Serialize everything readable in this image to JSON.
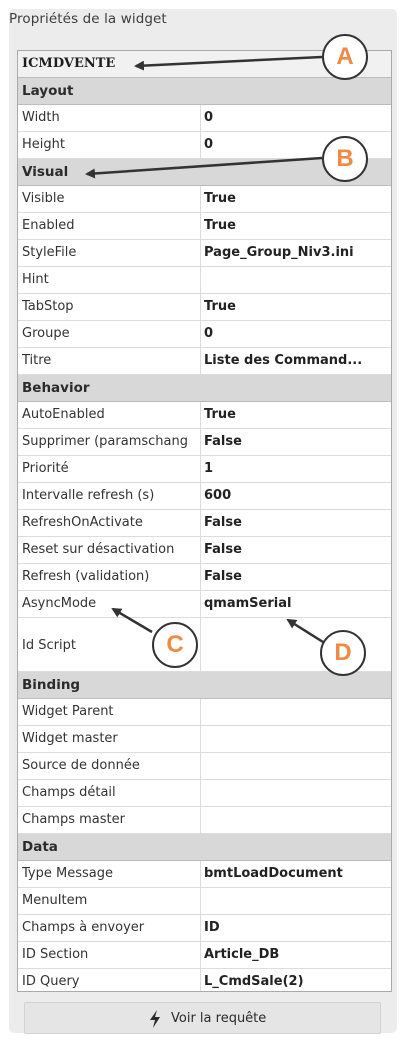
{
  "panel": {
    "title": "Propriétés de la widget"
  },
  "grid": {
    "rows": [
      {
        "kind": "header",
        "label": "ICMDVENTE",
        "value": ""
      },
      {
        "kind": "section",
        "label": "Layout",
        "value": ""
      },
      {
        "kind": "prop",
        "label": "Width",
        "value": "0"
      },
      {
        "kind": "prop",
        "label": "Height",
        "value": "0"
      },
      {
        "kind": "section",
        "label": "Visual",
        "value": ""
      },
      {
        "kind": "prop",
        "label": "Visible",
        "value": "True"
      },
      {
        "kind": "prop",
        "label": "Enabled",
        "value": "True"
      },
      {
        "kind": "prop",
        "label": "StyleFile",
        "value": "Page_Group_Niv3.ini"
      },
      {
        "kind": "prop",
        "label": "Hint",
        "value": ""
      },
      {
        "kind": "prop",
        "label": "TabStop",
        "value": "True"
      },
      {
        "kind": "prop",
        "label": "Groupe",
        "value": "0"
      },
      {
        "kind": "prop",
        "label": "Titre",
        "value": "Liste des Command..."
      },
      {
        "kind": "section",
        "label": "Behavior",
        "value": ""
      },
      {
        "kind": "prop",
        "label": "AutoEnabled",
        "value": "True"
      },
      {
        "kind": "prop",
        "label": "Supprimer (paramschang",
        "value": "False"
      },
      {
        "kind": "prop",
        "label": "Priorité",
        "value": "1"
      },
      {
        "kind": "prop",
        "label": "Intervalle refresh (s)",
        "value": "600"
      },
      {
        "kind": "prop",
        "label": "RefreshOnActivate",
        "value": "False"
      },
      {
        "kind": "prop",
        "label": "Reset sur désactivation",
        "value": "False"
      },
      {
        "kind": "prop",
        "label": "Refresh (validation)",
        "value": "False"
      },
      {
        "kind": "prop",
        "label": "AsyncMode",
        "value": "qmamSerial"
      },
      {
        "kind": "prop-tall",
        "label": "Id Script",
        "value": ""
      },
      {
        "kind": "section",
        "label": "Binding",
        "value": ""
      },
      {
        "kind": "prop",
        "label": "Widget Parent",
        "value": ""
      },
      {
        "kind": "prop",
        "label": "Widget master",
        "value": ""
      },
      {
        "kind": "prop",
        "label": "Source de donnée",
        "value": ""
      },
      {
        "kind": "prop",
        "label": "Champs détail",
        "value": ""
      },
      {
        "kind": "prop",
        "label": "Champs master",
        "value": ""
      },
      {
        "kind": "section",
        "label": "Data",
        "value": ""
      },
      {
        "kind": "prop",
        "label": "Type Message",
        "value": "bmtLoadDocument"
      },
      {
        "kind": "prop",
        "label": "MenuItem",
        "value": ""
      },
      {
        "kind": "prop",
        "label": "Champs à envoyer",
        "value": "ID"
      },
      {
        "kind": "prop",
        "label": "ID Section",
        "value": "Article_DB"
      },
      {
        "kind": "prop",
        "label": "ID Query",
        "value": "L_CmdSale(2)"
      }
    ]
  },
  "footer": {
    "button_label": "Voir la requête",
    "button_icon": "lightning-bolt-icon"
  },
  "callouts": [
    {
      "letter": "A"
    },
    {
      "letter": "B"
    },
    {
      "letter": "C"
    },
    {
      "letter": "D"
    }
  ],
  "colors": {
    "callout_letter": "#f08a45",
    "section_bg": "#d8d8d8",
    "panel_bg": "#ececec"
  }
}
